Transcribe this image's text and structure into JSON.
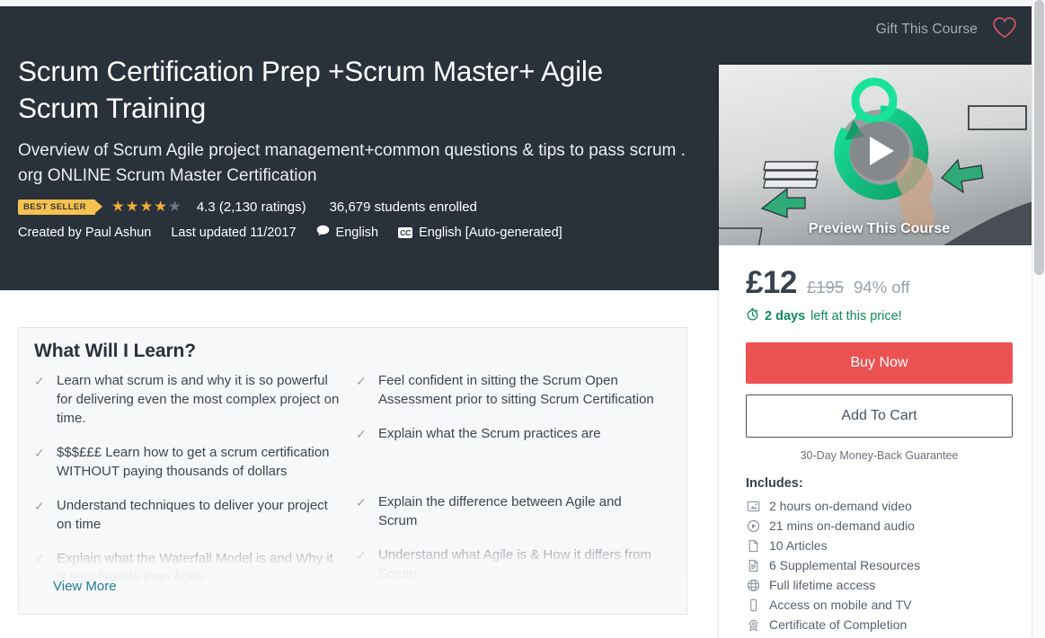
{
  "header": {
    "gift_label": "Gift This Course",
    "wishlist_icon": "heart-icon",
    "title": "Scrum Certification Prep +Scrum Master+ Agile Scrum Training",
    "subtitle": "Overview of Scrum Agile project management+common questions & tips to pass scrum . org ONLINE Scrum Master Certification",
    "badge": "BEST SELLER",
    "rating_value": "4.3",
    "rating_text": "4.3 (2,130 ratings)",
    "rating_count": "2,130 ratings",
    "stars_filled": 4,
    "stars_total": 5,
    "students": "36,679 students enrolled",
    "created_by": "Created by Paul Ashun",
    "last_updated": "Last updated 11/2017",
    "language": "English",
    "captions": "English [Auto-generated]",
    "caption_badge": "CC",
    "background_color": "#29313b"
  },
  "sidebar": {
    "preview_label": "Preview This Course",
    "play_icon": "play-icon",
    "price_current": "£12",
    "price_old": "£195",
    "discount": "94% off",
    "timer_icon": "stopwatch-icon",
    "timer_bold": "2 days",
    "timer_rest": " left at this price!",
    "buy_label": "Buy Now",
    "cart_label": "Add To Cart",
    "guarantee": "30-Day Money-Back Guarantee",
    "includes_title": "Includes:",
    "buy_color": "#ec5252",
    "timer_color": "#108a5a",
    "includes": [
      {
        "icon": "video-icon",
        "label": "2 hours on-demand video"
      },
      {
        "icon": "audio-play-icon",
        "label": "21 mins on-demand audio"
      },
      {
        "icon": "article-page-icon",
        "label": "10 Articles"
      },
      {
        "icon": "document-lines-icon",
        "label": "6 Supplemental Resources"
      },
      {
        "icon": "globe-icon",
        "label": "Full lifetime access"
      },
      {
        "icon": "mobile-icon",
        "label": "Access on mobile and TV"
      },
      {
        "icon": "certificate-icon",
        "label": "Certificate of Completion"
      }
    ]
  },
  "learn": {
    "title": "What Will I Learn?",
    "view_more": "View More",
    "view_more_color": "#1e7e95",
    "left_items": [
      "Learn what scrum is and why it is so powerful for delivering even the most complex project on time.",
      "$$$£££ Learn how to get a scrum certification WITHOUT paying thousands of dollars",
      "Understand techniques to deliver your project on time",
      "Explain what the Waterfall Model is and Why it is less flexible than Agile"
    ],
    "right_items": [
      "Feel confident in sitting the Scrum Open Assessment prior to sitting Scrum Certification",
      "Explain what the Scrum practices are",
      "Explain the difference between Agile and Scrum",
      "Understand what Agile is & How it differs from Scrum"
    ]
  }
}
